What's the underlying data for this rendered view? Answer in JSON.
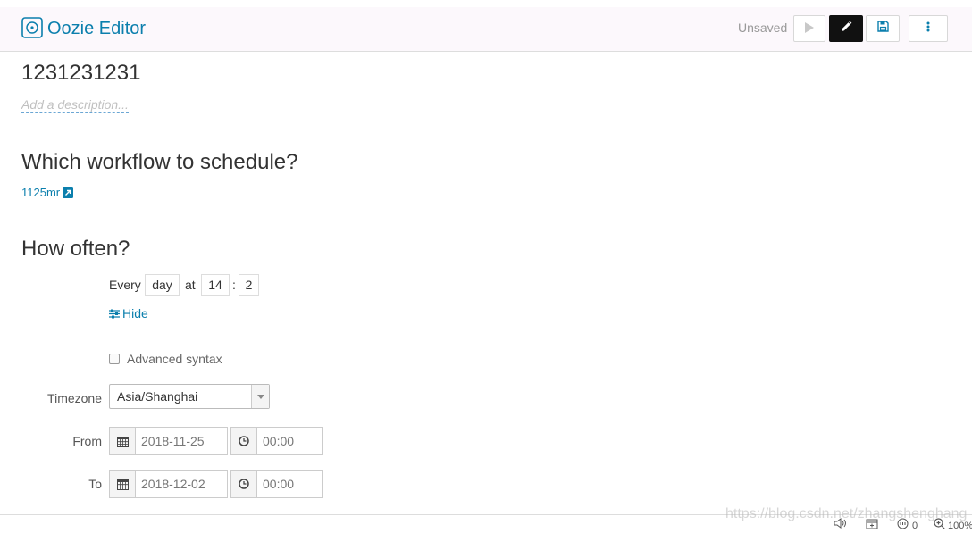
{
  "header": {
    "app_title": "Oozie Editor",
    "status": "Unsaved",
    "buttons": {
      "play_icon": "play-icon",
      "edit_icon": "pencil-icon",
      "save_icon": "save-icon",
      "more_icon": "more-vertical-icon"
    }
  },
  "coordinator": {
    "name": "1231231231",
    "description_placeholder": "Add a description..."
  },
  "workflow_section": {
    "heading": "Which workflow to schedule?",
    "workflow_link": "1125mr"
  },
  "frequency_section": {
    "heading": "How often?",
    "every_label": "Every",
    "unit": "day",
    "at_label": "at",
    "hour": "14",
    "separator": ":",
    "minute": "2",
    "hide_link": "Hide",
    "advanced_syntax_label": "Advanced syntax",
    "advanced_syntax_checked": false
  },
  "schedule": {
    "timezone_label": "Timezone",
    "timezone_value": "Asia/Shanghai",
    "from_label": "From",
    "from_date": "2018-11-25",
    "from_time": "00:00",
    "to_label": "To",
    "to_date": "2018-12-02",
    "to_time": "00:00"
  },
  "footer": {
    "watermark": "https://blog.csdn.net/zhangshenghang",
    "badge_count": "0",
    "zoom": "100%"
  },
  "colors": {
    "accent": "#0b7fad",
    "header_bg": "#fcf8fc",
    "edit_button_bg": "#111111"
  }
}
